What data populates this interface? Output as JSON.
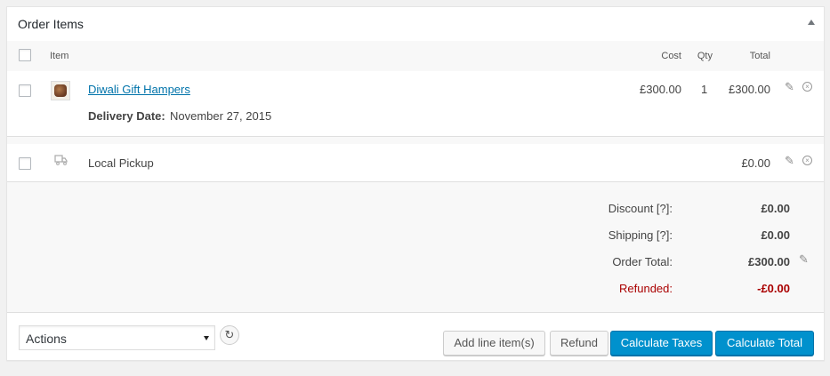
{
  "panel": {
    "title": "Order Items"
  },
  "columns": {
    "item": "Item",
    "cost": "Cost",
    "qty": "Qty",
    "total": "Total"
  },
  "line_items": [
    {
      "name": "Diwali Gift Hampers",
      "cost": "£300.00",
      "qty": "1",
      "total": "£300.00",
      "meta_label": "Delivery Date:",
      "meta_value": "November 27, 2015"
    }
  ],
  "shipping": {
    "name": "Local Pickup",
    "total": "£0.00"
  },
  "totals": {
    "discount_label": "Discount [?]:",
    "discount_value": "£0.00",
    "shipping_label": "Shipping [?]:",
    "shipping_value": "£0.00",
    "order_total_label": "Order Total:",
    "order_total_value": "£300.00",
    "refunded_label": "Refunded:",
    "refunded_value": "-£0.00"
  },
  "actions": {
    "select_value": "Actions",
    "add_line_items": "Add line item(s)",
    "refund": "Refund",
    "calculate_taxes": "Calculate Taxes",
    "calculate_total": "Calculate Total"
  },
  "colors": {
    "primary_button": "#0091cd",
    "link": "#0073aa",
    "refunded": "#a00"
  },
  "icons": {
    "collapse": "triangle-up-icon",
    "edit": "pencil-icon",
    "delete": "circle-x-icon",
    "shipping": "truck-icon",
    "reload": "reload-icon",
    "dropdown": "chevron-down-icon"
  }
}
